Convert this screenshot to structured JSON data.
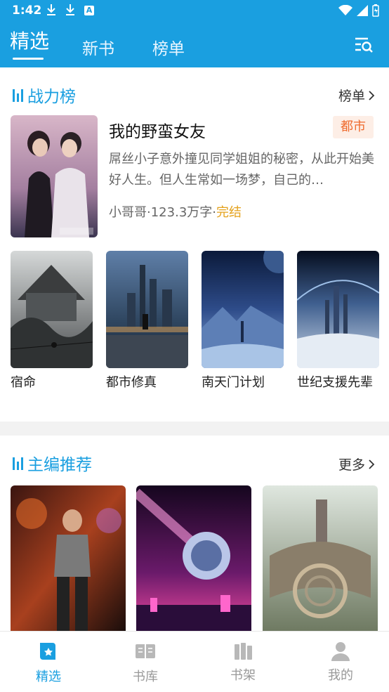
{
  "status_bar": {
    "time": "1:42"
  },
  "header": {
    "tabs": [
      {
        "label": "精选",
        "active": true
      },
      {
        "label": "新书",
        "active": false
      },
      {
        "label": "榜单",
        "active": false
      }
    ]
  },
  "ranking": {
    "title": "战力榜",
    "more_label": "榜单",
    "featured": {
      "title": "我的野蛮女友",
      "tag": "都市",
      "description": "屌丝小子意外撞见同学姐姐的秘密，从此开始美好人生。但人生常如一场梦，自己的…",
      "author": "小哥哥",
      "word_count": "123.3万字",
      "status": "完结"
    },
    "books": [
      {
        "title": "宿命"
      },
      {
        "title": "都市修真"
      },
      {
        "title": "南天门计划"
      },
      {
        "title": "世纪支援先辈"
      }
    ]
  },
  "editor_picks": {
    "title": "主编推荐",
    "more_label": "更多"
  },
  "bottom_nav": [
    {
      "label": "精选",
      "icon": "book-star-icon",
      "active": true
    },
    {
      "label": "书库",
      "icon": "open-book-icon",
      "active": false
    },
    {
      "label": "书架",
      "icon": "bookshelf-icon",
      "active": false
    },
    {
      "label": "我的",
      "icon": "user-icon",
      "active": false
    }
  ],
  "colors": {
    "accent": "#1a9fe0",
    "tag_bg": "#fdeee6",
    "tag_text": "#ef6b2e",
    "complete": "#e4a21c"
  }
}
